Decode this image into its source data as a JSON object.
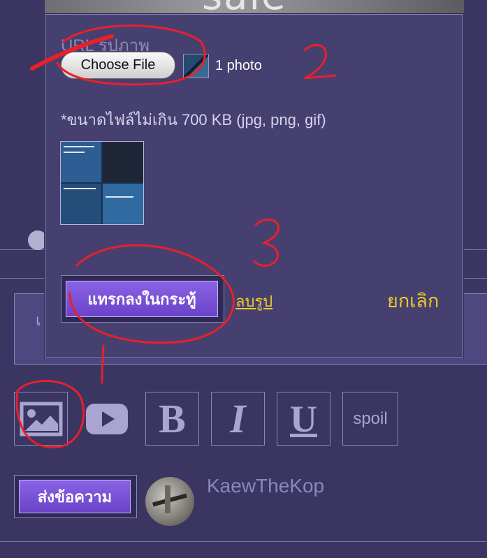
{
  "background": {
    "banner_text": "sale",
    "textarea_placeholder_visible": "เ"
  },
  "modal": {
    "url_label": "URL รูปภาพ",
    "choose_file_label": "Choose File",
    "file_count": "1 photo",
    "size_note": "*ขนาดไฟล์ไม่เกิน 700 KB (jpg, png, gif)",
    "insert_label": "แทรกลงในกระทู้",
    "delete_label": "ลบรูป",
    "cancel_label": "ยกเลิก"
  },
  "toolbar": {
    "image_icon": "image-icon",
    "video_icon": "youtube-play-icon",
    "bold_label": "B",
    "italic_label": "I",
    "underline_label": "U",
    "spoil_label": "spoil"
  },
  "footer": {
    "send_label": "ส่งข้อความ",
    "username": "KaewTheKop"
  },
  "annotations": {
    "numbers": [
      "1",
      "2",
      "3"
    ]
  },
  "colors": {
    "page_bg": "#3b3562",
    "modal_bg": "#45406f",
    "accent_button": "#7a52d8",
    "link_yellow": "#f0c92a",
    "annotation_red": "#e8202a"
  }
}
